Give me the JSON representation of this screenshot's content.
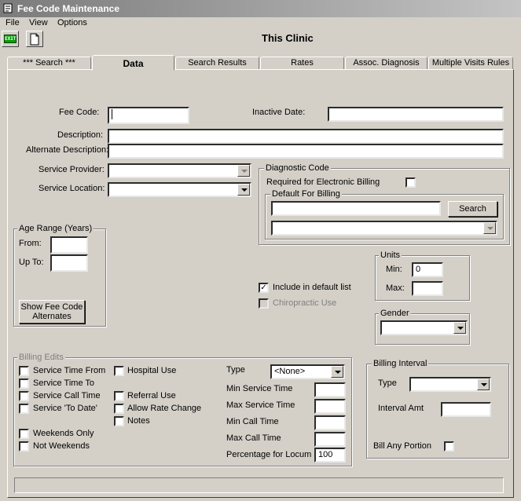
{
  "window": {
    "title": "Fee Code Maintenance"
  },
  "menu": [
    "File",
    "View",
    "Options"
  ],
  "toolbar": {
    "exit_label": "EXIT",
    "clinic": "This Clinic"
  },
  "tabs": [
    "*** Search ***",
    "Data",
    "Search Results",
    "Rates",
    "Assoc. Diagnosis",
    "Multiple Visits Rules"
  ],
  "fields": {
    "fee_code_label": "Fee Code:",
    "inactive_date_label": "Inactive Date:",
    "description_label": "Description:",
    "alt_description_label": "Alternate Description:",
    "service_provider_label": "Service Provider:",
    "service_location_label": "Service Location:"
  },
  "diagnostic": {
    "title": "Diagnostic Code",
    "required_label": "Required for Electronic Billing",
    "default_title": "Default For Billing",
    "search_button": "Search"
  },
  "age": {
    "title": "Age Range (Years)",
    "from_label": "From:",
    "upto_label": "Up To:",
    "alternates_button": "Show Fee Code Alternates"
  },
  "units": {
    "title": "Units",
    "min_label": "Min:",
    "min_value": "0",
    "max_label": "Max:"
  },
  "options": {
    "include_default": "Include in default list",
    "chiropractic": "Chiropractic Use"
  },
  "gender": {
    "title": "Gender"
  },
  "billing_edits": {
    "title": "Billing Edits",
    "checks_left": [
      "Service Time From",
      "Service Time To",
      "Service Call Time",
      "Service 'To Date'",
      "Weekends Only",
      "Not Weekends"
    ],
    "checks_mid": [
      "Hospital Use",
      "Referral Use",
      "Allow Rate Change",
      "Notes"
    ],
    "type_label": "Type",
    "type_value": "<None>",
    "min_service_time": "Min Service Time",
    "max_service_time": "Max Service Time",
    "min_call_time": "Min Call Time",
    "max_call_time": "Max Call Time",
    "locum_label": "Percentage for Locum",
    "locum_value": "100"
  },
  "billing_interval": {
    "title": "Billing Interval",
    "type_label": "Type",
    "interval_amt_label": "Interval Amt",
    "bill_any_portion": "Bill Any Portion"
  }
}
